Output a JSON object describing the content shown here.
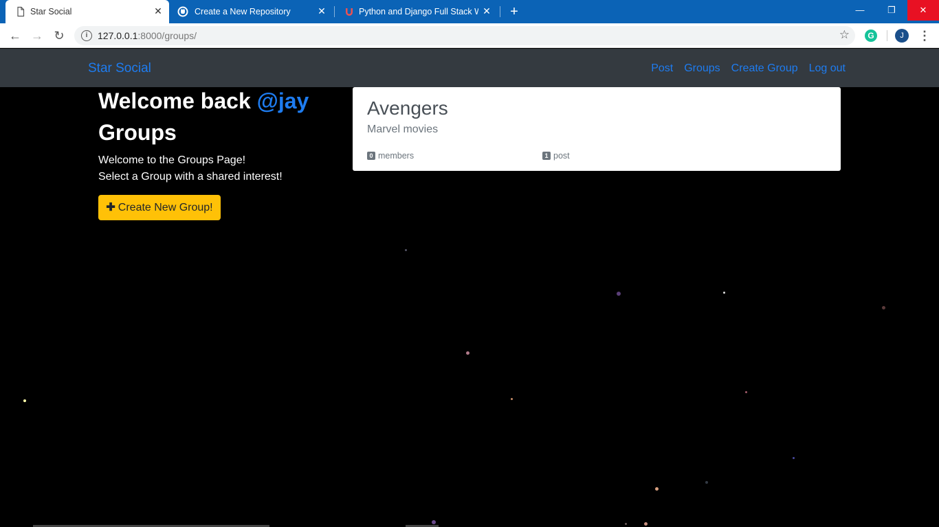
{
  "browser": {
    "tabs": [
      {
        "title": "Star Social",
        "active": true
      },
      {
        "title": "Create a New Repository",
        "active": false
      },
      {
        "title": "Python and Django Full Stack We",
        "active": false
      }
    ],
    "url_host": "127.0.0.1",
    "url_path": ":8000/groups/",
    "profile_initial": "J",
    "grammarly_initial": "G"
  },
  "navbar": {
    "brand": "Star Social",
    "links": [
      "Post",
      "Groups",
      "Create Group",
      "Log out"
    ]
  },
  "main": {
    "welcome_prefix": "Welcome back",
    "username": "@jay",
    "heading": "Groups",
    "intro_line1": "Welcome to the Groups Page!",
    "intro_line2": "Select a Group with a shared interest!",
    "create_button": "Create New Group!"
  },
  "groups": [
    {
      "name": "Avengers",
      "description": "Marvel movies",
      "members_count": "0",
      "members_label": "members",
      "posts_count": "1",
      "posts_label": "post"
    }
  ],
  "colors": {
    "accent": "#1e7cf0",
    "button": "#ffc107",
    "navbar": "#343a40",
    "chrome": "#0b63b6"
  }
}
